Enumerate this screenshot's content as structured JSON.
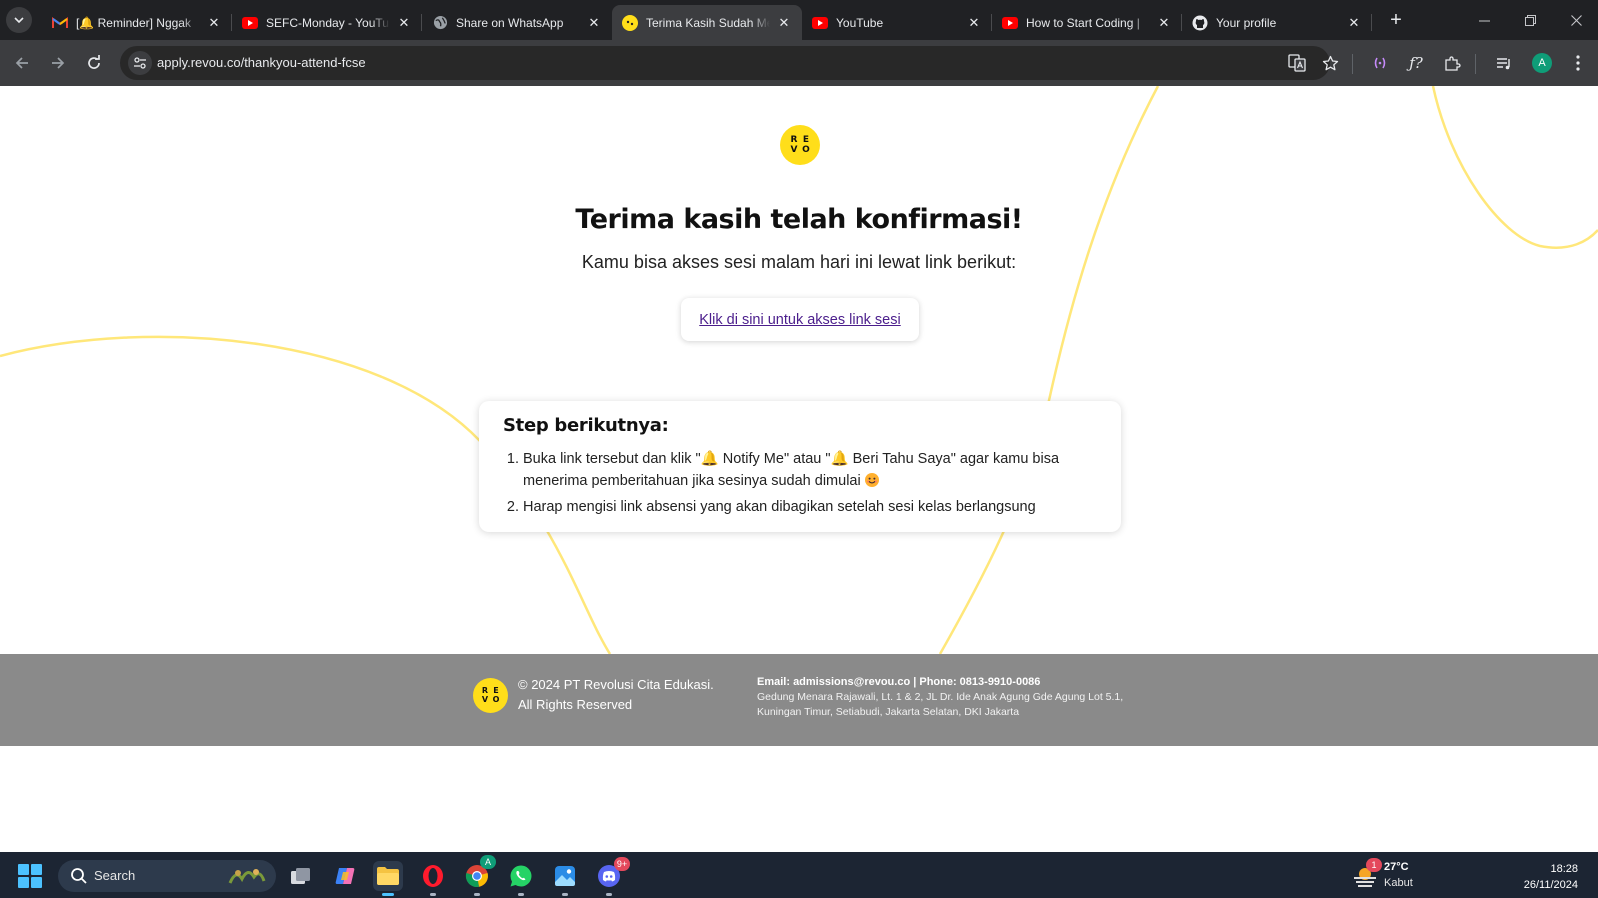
{
  "browser": {
    "tabs": [
      {
        "title": "[🔔 Reminder] Nggak",
        "icon": "gmail-icon",
        "active": false
      },
      {
        "title": "SEFC-Monday - YouTu",
        "icon": "youtube-icon",
        "active": false
      },
      {
        "title": "Share on WhatsApp",
        "icon": "globe-icon",
        "active": false
      },
      {
        "title": "Terima Kasih Sudah Me",
        "icon": "revou-icon",
        "active": true
      },
      {
        "title": "YouTube",
        "icon": "youtube-icon",
        "active": false
      },
      {
        "title": "How to Start Coding | ",
        "icon": "youtube-icon",
        "active": false
      },
      {
        "title": "Your profile",
        "icon": "github-icon",
        "active": false
      }
    ],
    "url": "apply.revou.co/thankyou-attend-fcse",
    "profile_initial": "A"
  },
  "page": {
    "logo_letters": [
      "R",
      "E",
      "V",
      "O"
    ],
    "heading": "Terima kasih telah konfirmasi!",
    "subheading": "Kamu bisa akses sesi malam hari ini lewat link berikut:",
    "session_link": "Klik di sini untuk akses link sesi",
    "steps_title": "Step berikutnya:",
    "step1_a": "Buka link tersebut dan klik \"",
    "step1_b": "Notify Me",
    "step1_c": "\" atau \"",
    "step1_d": "Beri Tahu Saya",
    "step1_e": "\" agar kamu bisa menerima pemberitahuan jika sesinya sudah dimulai",
    "step2": "Harap mengisi link absensi yang akan dibagikan setelah sesi kelas berlangsung",
    "accent_color": "#ffde1a",
    "link_color": "#4b1e8c"
  },
  "footer": {
    "copyright_line1": "© 2024 PT Revolusi Cita Edukasi.",
    "copyright_line2": "All Rights Reserved",
    "contact": "Email: admissions@revou.co | Phone: 0813-9910-0086",
    "address_line1": "Gedung Menara Rajawali, Lt. 1 & 2, JL Dr. Ide Anak Agung Gde Agung Lot 5.1,",
    "address_line2": "Kuningan Timur, Setiabudi, Jakarta Selatan, DKI Jakarta"
  },
  "taskbar": {
    "search_label": "Search",
    "discord_badge": "9+",
    "weather_badge": "1",
    "temperature": "27°C",
    "weather_desc": "Kabut",
    "time": "18:28",
    "date": "26/11/2024"
  }
}
